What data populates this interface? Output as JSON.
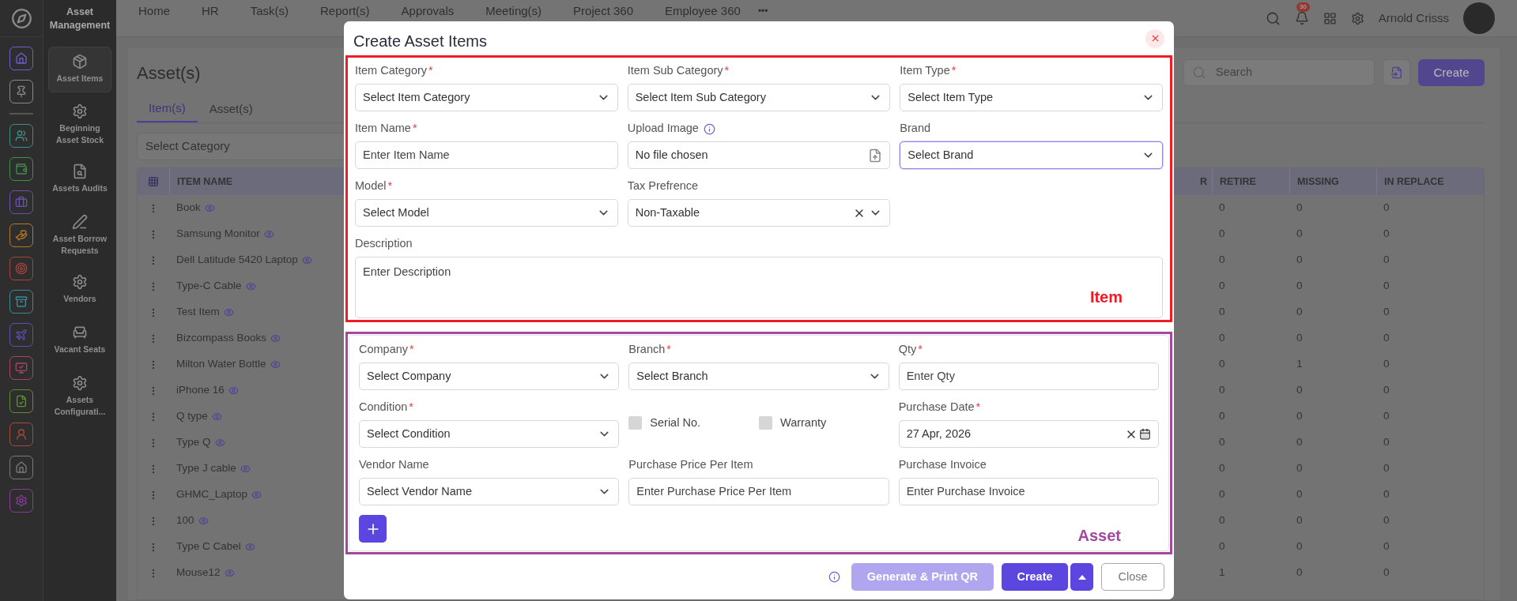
{
  "app": {
    "title": "Asset Management"
  },
  "nav": {
    "items": [
      "Home",
      "HR",
      "Task(s)",
      "Report(s)",
      "Approvals",
      "Meeting(s)",
      "Project 360",
      "Employee 360"
    ],
    "more": "•••",
    "notifications": "30",
    "user": "Arnold Crisss"
  },
  "sidebar": {
    "items": [
      {
        "label": "Asset Items",
        "selected": true
      },
      {
        "label": "Beginning Asset Stock",
        "selected": false
      },
      {
        "label": "Assets Audits",
        "selected": false
      },
      {
        "label": "Asset Borrow Requests",
        "selected": false
      },
      {
        "label": "Vendors",
        "selected": false
      },
      {
        "label": "Vacant Seats",
        "selected": false
      },
      {
        "label": "Assets Configurati...",
        "selected": false
      }
    ]
  },
  "page": {
    "title": "Asset(s)",
    "search_placeholder": "Search",
    "create": "Create",
    "tabs": [
      {
        "label": "Item(s)",
        "selected": true
      },
      {
        "label": "Asset(s)",
        "selected": false
      }
    ],
    "category_placeholder": "Select Category"
  },
  "table": {
    "columns": [
      "ITEM NAME",
      "R",
      "RETIRE",
      "MISSING",
      "IN REPLACE"
    ],
    "rows": [
      {
        "cells": [
          "Book",
          "",
          "0",
          "0",
          "0"
        ]
      },
      {
        "cells": [
          "Samsung Monitor",
          "",
          "0",
          "0",
          "0"
        ]
      },
      {
        "cells": [
          "Dell Latitude 5420 Laptop",
          "",
          "0",
          "0",
          "0"
        ]
      },
      {
        "cells": [
          "Type-C Cable",
          "",
          "0",
          "0",
          "0"
        ]
      },
      {
        "cells": [
          "Test Item",
          "",
          "0",
          "0",
          "0"
        ]
      },
      {
        "cells": [
          "Bizcompass Books",
          "",
          "0",
          "0",
          "0"
        ]
      },
      {
        "cells": [
          "Milton Water Bottle",
          "",
          "0",
          "1",
          "0"
        ]
      },
      {
        "cells": [
          "iPhone 16",
          "",
          "0",
          "0",
          "0"
        ]
      },
      {
        "cells": [
          "Q type",
          "",
          "0",
          "0",
          "0"
        ]
      },
      {
        "cells": [
          "Type Q",
          "",
          "0",
          "0",
          "0"
        ]
      },
      {
        "cells": [
          "Type J cable",
          "",
          "0",
          "0",
          "0"
        ]
      },
      {
        "cells": [
          "GHMC_Laptop",
          "",
          "0",
          "0",
          "0"
        ]
      },
      {
        "cells": [
          "100",
          "",
          "0",
          "0",
          "0"
        ]
      },
      {
        "cells": [
          "Type C Cabel",
          "",
          "0",
          "0",
          "0"
        ]
      },
      {
        "cells": [
          "Mouse12",
          "",
          "1",
          "0",
          "0"
        ]
      }
    ]
  },
  "modal": {
    "title": "Create Asset Items",
    "item_section": {
      "label": "Item",
      "fields": [
        {
          "kind": "select",
          "label": "Item Category",
          "required_mark": "*",
          "placeholder": "Select Item Category",
          "focused": false
        },
        {
          "kind": "select",
          "label": "Item Sub Category",
          "required_mark": "*",
          "placeholder": "Select Item Sub Category",
          "focused": false
        },
        {
          "kind": "select",
          "label": "Item Type",
          "required_mark": "*",
          "placeholder": "Select Item Type",
          "focused": false
        },
        {
          "kind": "input",
          "label": "Item Name",
          "required_mark": "*",
          "placeholder": "Enter Item Name"
        },
        {
          "kind": "file",
          "label": "Upload Image",
          "value": "No file chosen"
        },
        {
          "kind": "select",
          "label": "Brand",
          "placeholder": "Select Brand",
          "focused": true
        },
        {
          "kind": "select",
          "label": "Model",
          "required_mark": "*",
          "placeholder": "Select Model",
          "focused": false
        },
        {
          "kind": "clearable",
          "label": "Tax Prefrence",
          "value": "Non-Taxable"
        },
        {
          "kind": "textarea",
          "label": "Description",
          "placeholder": "Enter Description"
        }
      ]
    },
    "asset_section": {
      "label": "Asset",
      "fields": [
        {
          "kind": "select",
          "label": "Company",
          "required_mark": "*",
          "placeholder": "Select Company",
          "focused": false
        },
        {
          "kind": "select",
          "label": "Branch",
          "required_mark": "*",
          "placeholder": "Select Branch",
          "focused": false
        },
        {
          "kind": "input",
          "label": "Qty",
          "required_mark": "*",
          "placeholder": "Enter Qty"
        },
        {
          "kind": "select",
          "label": "Condition",
          "required_mark": "*",
          "placeholder": "Select Condition",
          "focused": false
        },
        {
          "kind": "checks",
          "items": [
            {
              "label": "Serial No.",
              "checked": false
            },
            {
              "label": "Warranty",
              "checked": false
            }
          ]
        },
        {
          "kind": "date",
          "label": "Purchase Date",
          "required_mark": "*",
          "value": "27 Apr, 2026"
        },
        {
          "kind": "select",
          "label": "Vendor Name",
          "placeholder": "Select Vendor Name",
          "focused": false
        },
        {
          "kind": "input",
          "label": "Purchase Price Per Item",
          "placeholder": "Enter Purchase Price Per Item"
        },
        {
          "kind": "input",
          "label": "Purchase Invoice",
          "placeholder": "Enter Purchase Invoice"
        }
      ]
    },
    "footer": {
      "qr": {
        "label": "Generate & Print QR",
        "disabled": true
      },
      "create": "Create",
      "close": "Close"
    }
  }
}
